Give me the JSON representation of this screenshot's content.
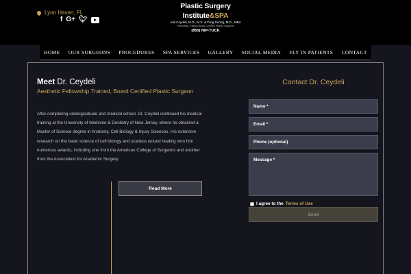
{
  "header": {
    "location": "Lynn Haven, FL",
    "social": [
      "facebook",
      "google-plus",
      "twitter",
      "youtube"
    ],
    "logo": {
      "title": "Plastic Surgery Institute",
      "title_accent": "&SPA",
      "doctors": "Adil Ceydeli, M.D., M.S. & Tong Duong, M.D., MBA",
      "tagline": "Fellowship-Trained Board-Certified Plastic Surgeons",
      "phone": "(850) NIP-TUCK"
    }
  },
  "nav": {
    "items": [
      "HOME",
      "OUR SURGEONS",
      "PROCEDURES",
      "SPA SERVICES",
      "GALLERY",
      "SOCIAL MEDIA",
      "FLY IN PATIENTS",
      "CONTACT"
    ]
  },
  "main": {
    "meet_bold": "Meet",
    "meet_rest": " Dr. Ceydeli",
    "subtitle": "Aesthetic Fellowship Trained, Board Certified Plastic Surgeon",
    "bio": "After completing undergraduate and medical school, Dr. Ceydeli continued his medical training at the University of Medicine & Dentistry of New Jersey, where he obtained a Master of Science degree in Anatomy, Cell Biology & Injury Sciences. His extensive research on the basic science of cell biology and scarless wound healing won him numerous awards, including one from the American College of Surgeons and another from the Association for Academic Surgery.",
    "read_more": "Read More"
  },
  "contact": {
    "title": "Contact Dr. Ceydeli",
    "name_placeholder": "Name *",
    "email_placeholder": "Email *",
    "phone_placeholder": "Phone (optional)",
    "message_placeholder": "Message *",
    "agree_text": "I agree to the ",
    "terms_link": "Terms of Use",
    "send": "Send"
  },
  "colors": {
    "accent": "#c9a65a",
    "background": "#15161d",
    "header": "#000000"
  }
}
